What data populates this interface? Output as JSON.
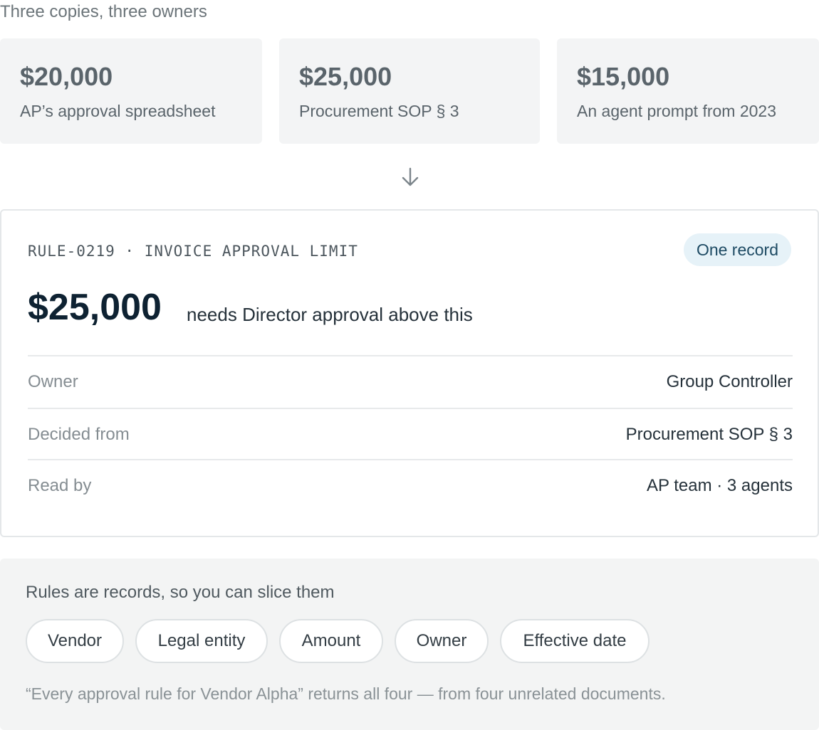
{
  "header": {
    "title": "Three copies, three owners"
  },
  "copies": [
    {
      "amount": "$20,000",
      "source": "AP’s approval spreadsheet"
    },
    {
      "amount": "$25,000",
      "source": "Procurement SOP § 3"
    },
    {
      "amount": "$15,000",
      "source": "An agent prompt from 2023"
    }
  ],
  "icons": {
    "arrow": "arrow-down-icon"
  },
  "record": {
    "rule_id": "RULE-0219 · INVOICE APPROVAL LIMIT",
    "badge": "One record",
    "amount": "$25,000",
    "description": "needs Director approval above this",
    "meta": [
      {
        "key": "Owner",
        "value": "Group Controller"
      },
      {
        "key": "Decided from",
        "value": "Procurement SOP § 3"
      },
      {
        "key": "Read by",
        "value": "AP team · 3 agents"
      }
    ]
  },
  "slice": {
    "title": "Rules are records, so you can slice them",
    "chips": [
      "Vendor",
      "Legal entity",
      "Amount",
      "Owner",
      "Effective date"
    ],
    "note": "“Every approval rule for Vendor Alpha” returns all four — from four unrelated documents."
  },
  "colors": {
    "badge_bg": "#e6f2f8",
    "badge_text": "#1d4a63",
    "card_bg": "#f3f4f5"
  }
}
